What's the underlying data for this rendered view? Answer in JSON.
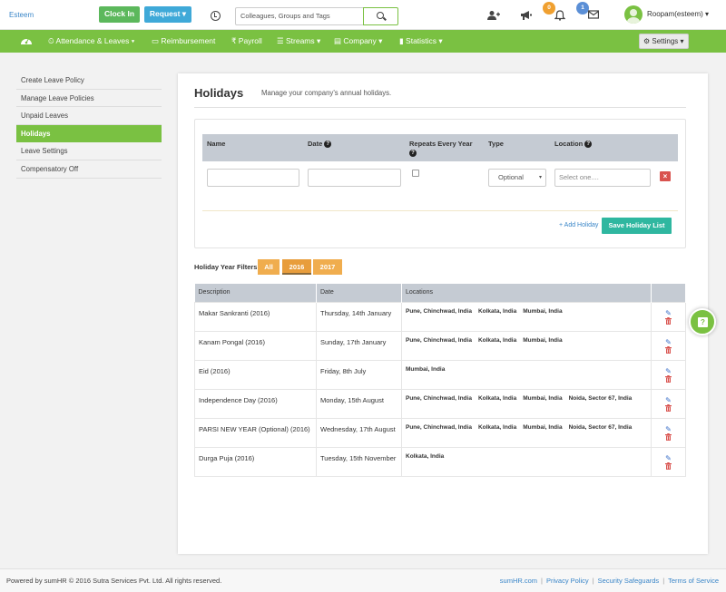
{
  "topbar": {
    "brand": "Esteem",
    "clock_in": "Clock In",
    "request": "Request ▾",
    "search_placeholder": "Colleagues, Groups and Tags",
    "notif_count_orange": "0",
    "notif_count_blue": "1",
    "user_name": "Roopam(esteem) ▾"
  },
  "nav": {
    "items": [
      "⏲ Attendance & Leaves ▾",
      "▭ Reimbursement",
      "₹ Payroll",
      "☰ Streams ▾",
      "▤ Company ▾",
      "▮ Statistics ▾"
    ],
    "settings": "⚙ Settings ▾"
  },
  "sidebar": {
    "items": [
      "Create Leave Policy",
      "Manage Leave Policies",
      "Unpaid Leaves",
      "Holidays",
      "Leave Settings",
      "Compensatory Off"
    ]
  },
  "page": {
    "title": "Holidays",
    "subtitle": "Manage your company's annual holidays."
  },
  "form": {
    "headers": {
      "name": "Name",
      "date": "Date",
      "repeats": "Repeats Every Year",
      "type": "Type",
      "location": "Location"
    },
    "type_value": "Optional",
    "location_placeholder": "Select one....",
    "add_holiday": "+ Add Holiday",
    "save": "Save Holiday List"
  },
  "filters": {
    "label": "Holiday Year Filters:",
    "years": [
      "All",
      "2016",
      "2017"
    ],
    "selected": "2016"
  },
  "table": {
    "columns": [
      "Description",
      "Date",
      "Locations"
    ],
    "rows": [
      {
        "description": "Makar Sankranti (2016)",
        "date": "Thursday, 14th January",
        "locations": [
          "Pune, Chinchwad, India",
          "Kolkata, India",
          "Mumbai, India"
        ]
      },
      {
        "description": "Kanam Pongal (2016)",
        "date": "Sunday, 17th January",
        "locations": [
          "Pune, Chinchwad, India",
          "Kolkata, India",
          "Mumbai, India"
        ]
      },
      {
        "description": "Eid (2016)",
        "date": "Friday, 8th July",
        "locations": [
          "Mumbai, India"
        ]
      },
      {
        "description": "Independence Day (2016)",
        "date": "Monday, 15th August",
        "locations": [
          "Pune, Chinchwad, India",
          "Kolkata, India",
          "Mumbai, India",
          "Noida, Sector 67, India"
        ]
      },
      {
        "description": "PARSI NEW YEAR (Optional) (2016)",
        "date": "Wednesday, 17th August",
        "locations": [
          "Pune, Chinchwad, India",
          "Kolkata, India",
          "Mumbai, India",
          "Noida, Sector 67, India"
        ]
      },
      {
        "description": "Durga Puja (2016)",
        "date": "Tuesday, 15th November",
        "locations": [
          "Kolkata, India"
        ]
      }
    ]
  },
  "footer": {
    "copyright": "Powered by sumHR © 2016 Sutra Services Pvt. Ltd. All rights reserved.",
    "links": [
      "sumHR.com",
      "Privacy Policy",
      "Security Safeguards",
      "Terms of Service"
    ]
  },
  "colors": {
    "accent": "#7ac142",
    "link": "#3a86c8",
    "save": "#2fb7a0",
    "year_button": "#f0ad4e",
    "danger": "#d9534f"
  },
  "icons": [
    "clock-icon",
    "add-user-icon",
    "megaphone-icon",
    "bell-icon",
    "envelope-icon",
    "dashboard-gauge-icon",
    "search-icon",
    "edit-pencil-icon",
    "trash-icon",
    "help-icon"
  ]
}
